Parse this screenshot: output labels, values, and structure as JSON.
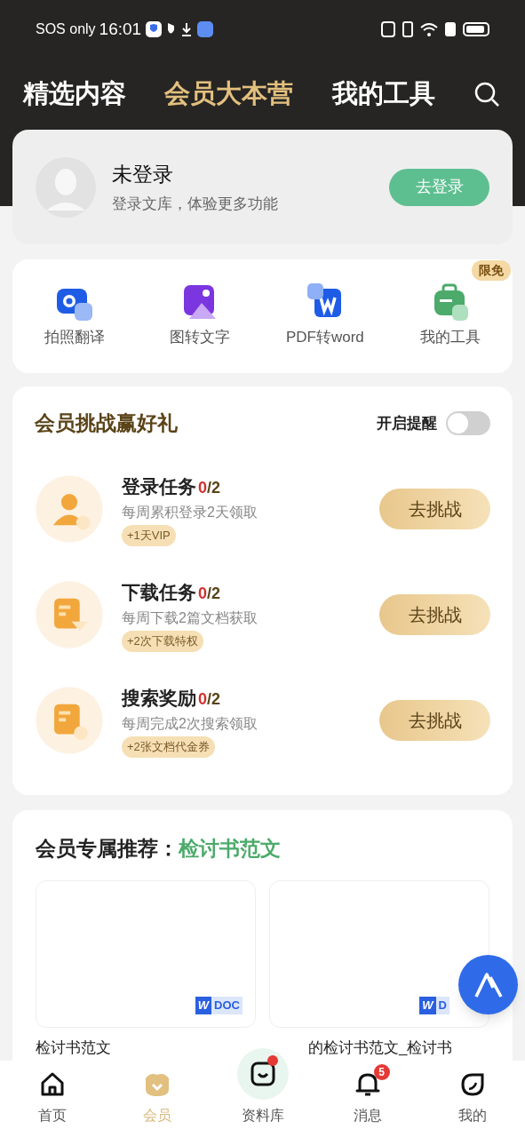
{
  "status_bar": {
    "carrier": "SOS only",
    "time": "16:01"
  },
  "tabs": [
    {
      "label": "精选内容",
      "selected": false
    },
    {
      "label": "会员大本营",
      "selected": true
    },
    {
      "label": "我的工具",
      "selected": false
    }
  ],
  "login": {
    "title": "未登录",
    "subtitle": "登录文库，体验更多功能",
    "button": "去登录"
  },
  "tools": [
    {
      "kind": "camera",
      "label": "拍照翻译"
    },
    {
      "kind": "image",
      "label": "图转文字"
    },
    {
      "kind": "pdf",
      "label": "PDF转word"
    },
    {
      "kind": "toolbox",
      "label": "我的工具",
      "badge": "限免"
    }
  ],
  "challenge": {
    "title": "会员挑战赢好礼",
    "reminder_label": "开启提醒",
    "reminder_on": false,
    "tasks": [
      {
        "kind": "login",
        "title": "登录任务",
        "done": "0",
        "total": "/2",
        "desc": "每周累积登录2天领取",
        "reward": "+1天VIP",
        "button": "去挑战"
      },
      {
        "kind": "download",
        "title": "下载任务",
        "done": "0",
        "total": "/2",
        "desc": "每周下载2篇文档获取",
        "reward": "+2次下载特权",
        "button": "去挑战"
      },
      {
        "kind": "search",
        "title": "搜索奖励",
        "done": "0",
        "total": "/2",
        "desc": "每周完成2次搜索领取",
        "reward": "+2张文档代金券",
        "button": "去挑战"
      }
    ]
  },
  "recommend": {
    "title": "会员专属推荐：",
    "keyword": "检讨书范文",
    "docs": [
      {
        "logo": "W",
        "type": "DOC",
        "title": "检讨书范文"
      },
      {
        "logo": "W",
        "type": "D",
        "title": "的检讨书范文_检讨书"
      }
    ]
  },
  "nav": [
    {
      "kind": "home",
      "label": "首页",
      "selected": false
    },
    {
      "kind": "vip",
      "label": "会员",
      "selected": true
    },
    {
      "kind": "library",
      "label": "资料库",
      "selected": false,
      "dot": true
    },
    {
      "kind": "bell",
      "label": "消息",
      "selected": false,
      "count": "5"
    },
    {
      "kind": "me",
      "label": "我的",
      "selected": false
    }
  ]
}
